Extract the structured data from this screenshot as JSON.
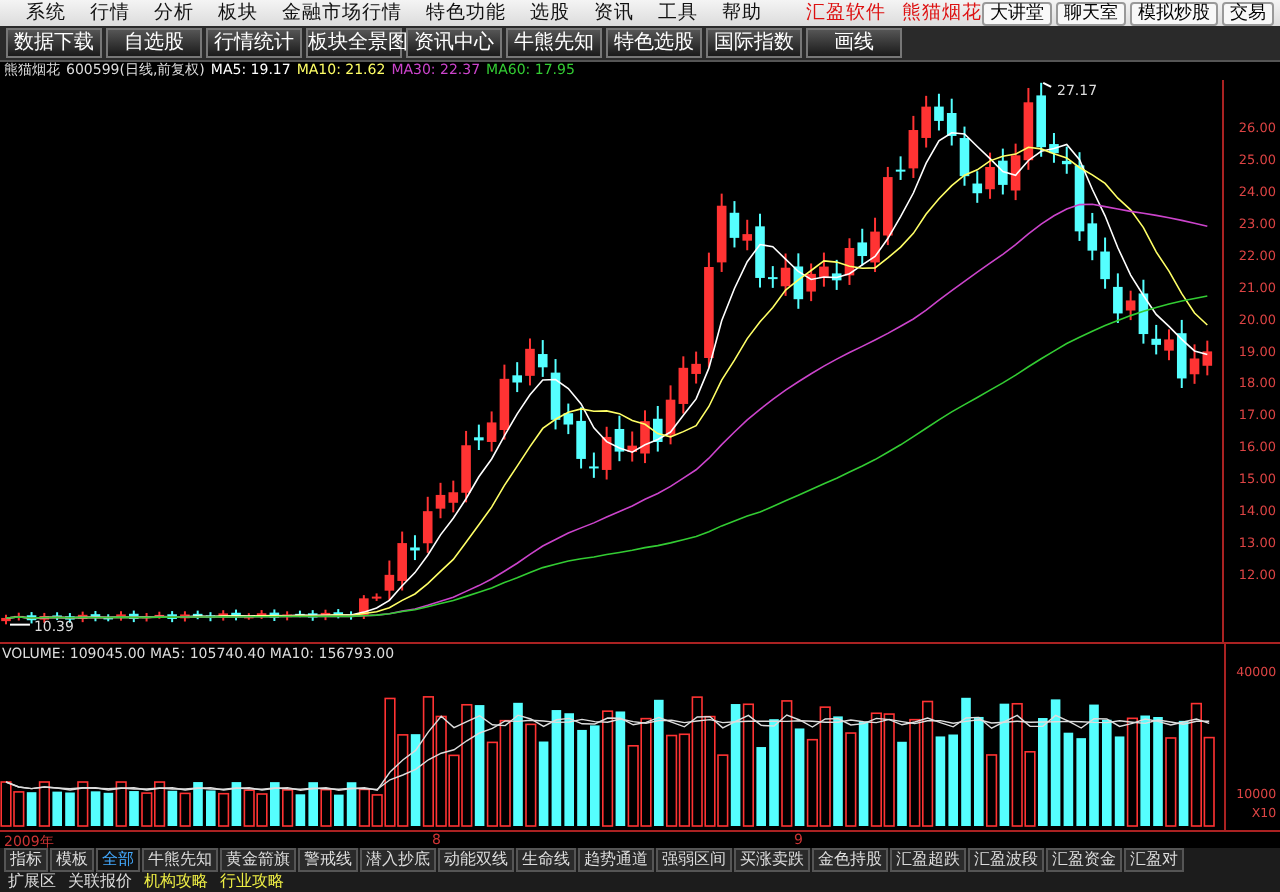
{
  "menu_bar": {
    "items": [
      "系统",
      "行情",
      "分析",
      "板块",
      "金融市场行情",
      "特色功能",
      "选股",
      "资讯",
      "工具",
      "帮助"
    ],
    "brand": [
      "汇盈软件",
      "熊猫烟花"
    ],
    "buttons": [
      "大讲堂",
      "聊天室",
      "模拟炒股",
      "交易"
    ]
  },
  "toolbar": {
    "buttons": [
      "数据下载",
      "自选股",
      "行情统计",
      "板块全景图",
      "资讯中心",
      "牛熊先知",
      "特色选股",
      "国际指数",
      "画线"
    ]
  },
  "chart_header": {
    "stock": "熊猫烟花",
    "code": "600599(日线,前复权)",
    "indicators": [
      {
        "label": "MA5: 19.17",
        "color": "#ffffff"
      },
      {
        "label": "MA10: 21.62",
        "color": "#ffff66"
      },
      {
        "label": "MA30: 22.37",
        "color": "#cc44cc"
      },
      {
        "label": "MA60: 17.95",
        "color": "#33cc33"
      }
    ]
  },
  "price_chart": {
    "high_label": "27.17",
    "low_label": "10.39",
    "axis_labels": [
      "26.00",
      "25.00",
      "24.00",
      "23.00",
      "22.00",
      "21.00",
      "20.00",
      "19.00",
      "18.00",
      "17.00",
      "16.00",
      "15.00",
      "14.00",
      "13.00",
      "12.00"
    ]
  },
  "volume_chart": {
    "header": "VOLUME: 109045.00 MA5: 105740.40 MA10: 156793.00",
    "axis_labels": [
      "40000",
      "10000",
      "X10"
    ]
  },
  "date_axis": [
    "2009年",
    "8",
    "9"
  ],
  "indicator_tabs": [
    {
      "label": "指标",
      "selected": false
    },
    {
      "label": "模板",
      "selected": false
    },
    {
      "label": "全部",
      "selected": true
    },
    {
      "label": "牛熊先知",
      "selected": false
    },
    {
      "label": "黄金箭旗",
      "selected": false
    },
    {
      "label": "警戒线",
      "selected": false
    },
    {
      "label": "潜入抄底",
      "selected": false
    },
    {
      "label": "动能双线",
      "selected": false
    },
    {
      "label": "生命线",
      "selected": false
    },
    {
      "label": "趋势通道",
      "selected": false
    },
    {
      "label": "强弱区间",
      "selected": false
    },
    {
      "label": "买涨卖跌",
      "selected": false
    },
    {
      "label": "金色持股",
      "selected": false
    },
    {
      "label": "汇盈超跌",
      "selected": false
    },
    {
      "label": "汇盈波段",
      "selected": false
    },
    {
      "label": "汇盈资金",
      "selected": false
    },
    {
      "label": "汇盈对",
      "selected": false
    }
  ],
  "bottom_tabs": [
    {
      "label": "扩展区",
      "highlighted": false
    },
    {
      "label": "关联报价",
      "highlighted": false
    },
    {
      "label": "机构攻略",
      "highlighted": true
    },
    {
      "label": "行业攻略",
      "highlighted": true
    }
  ]
}
